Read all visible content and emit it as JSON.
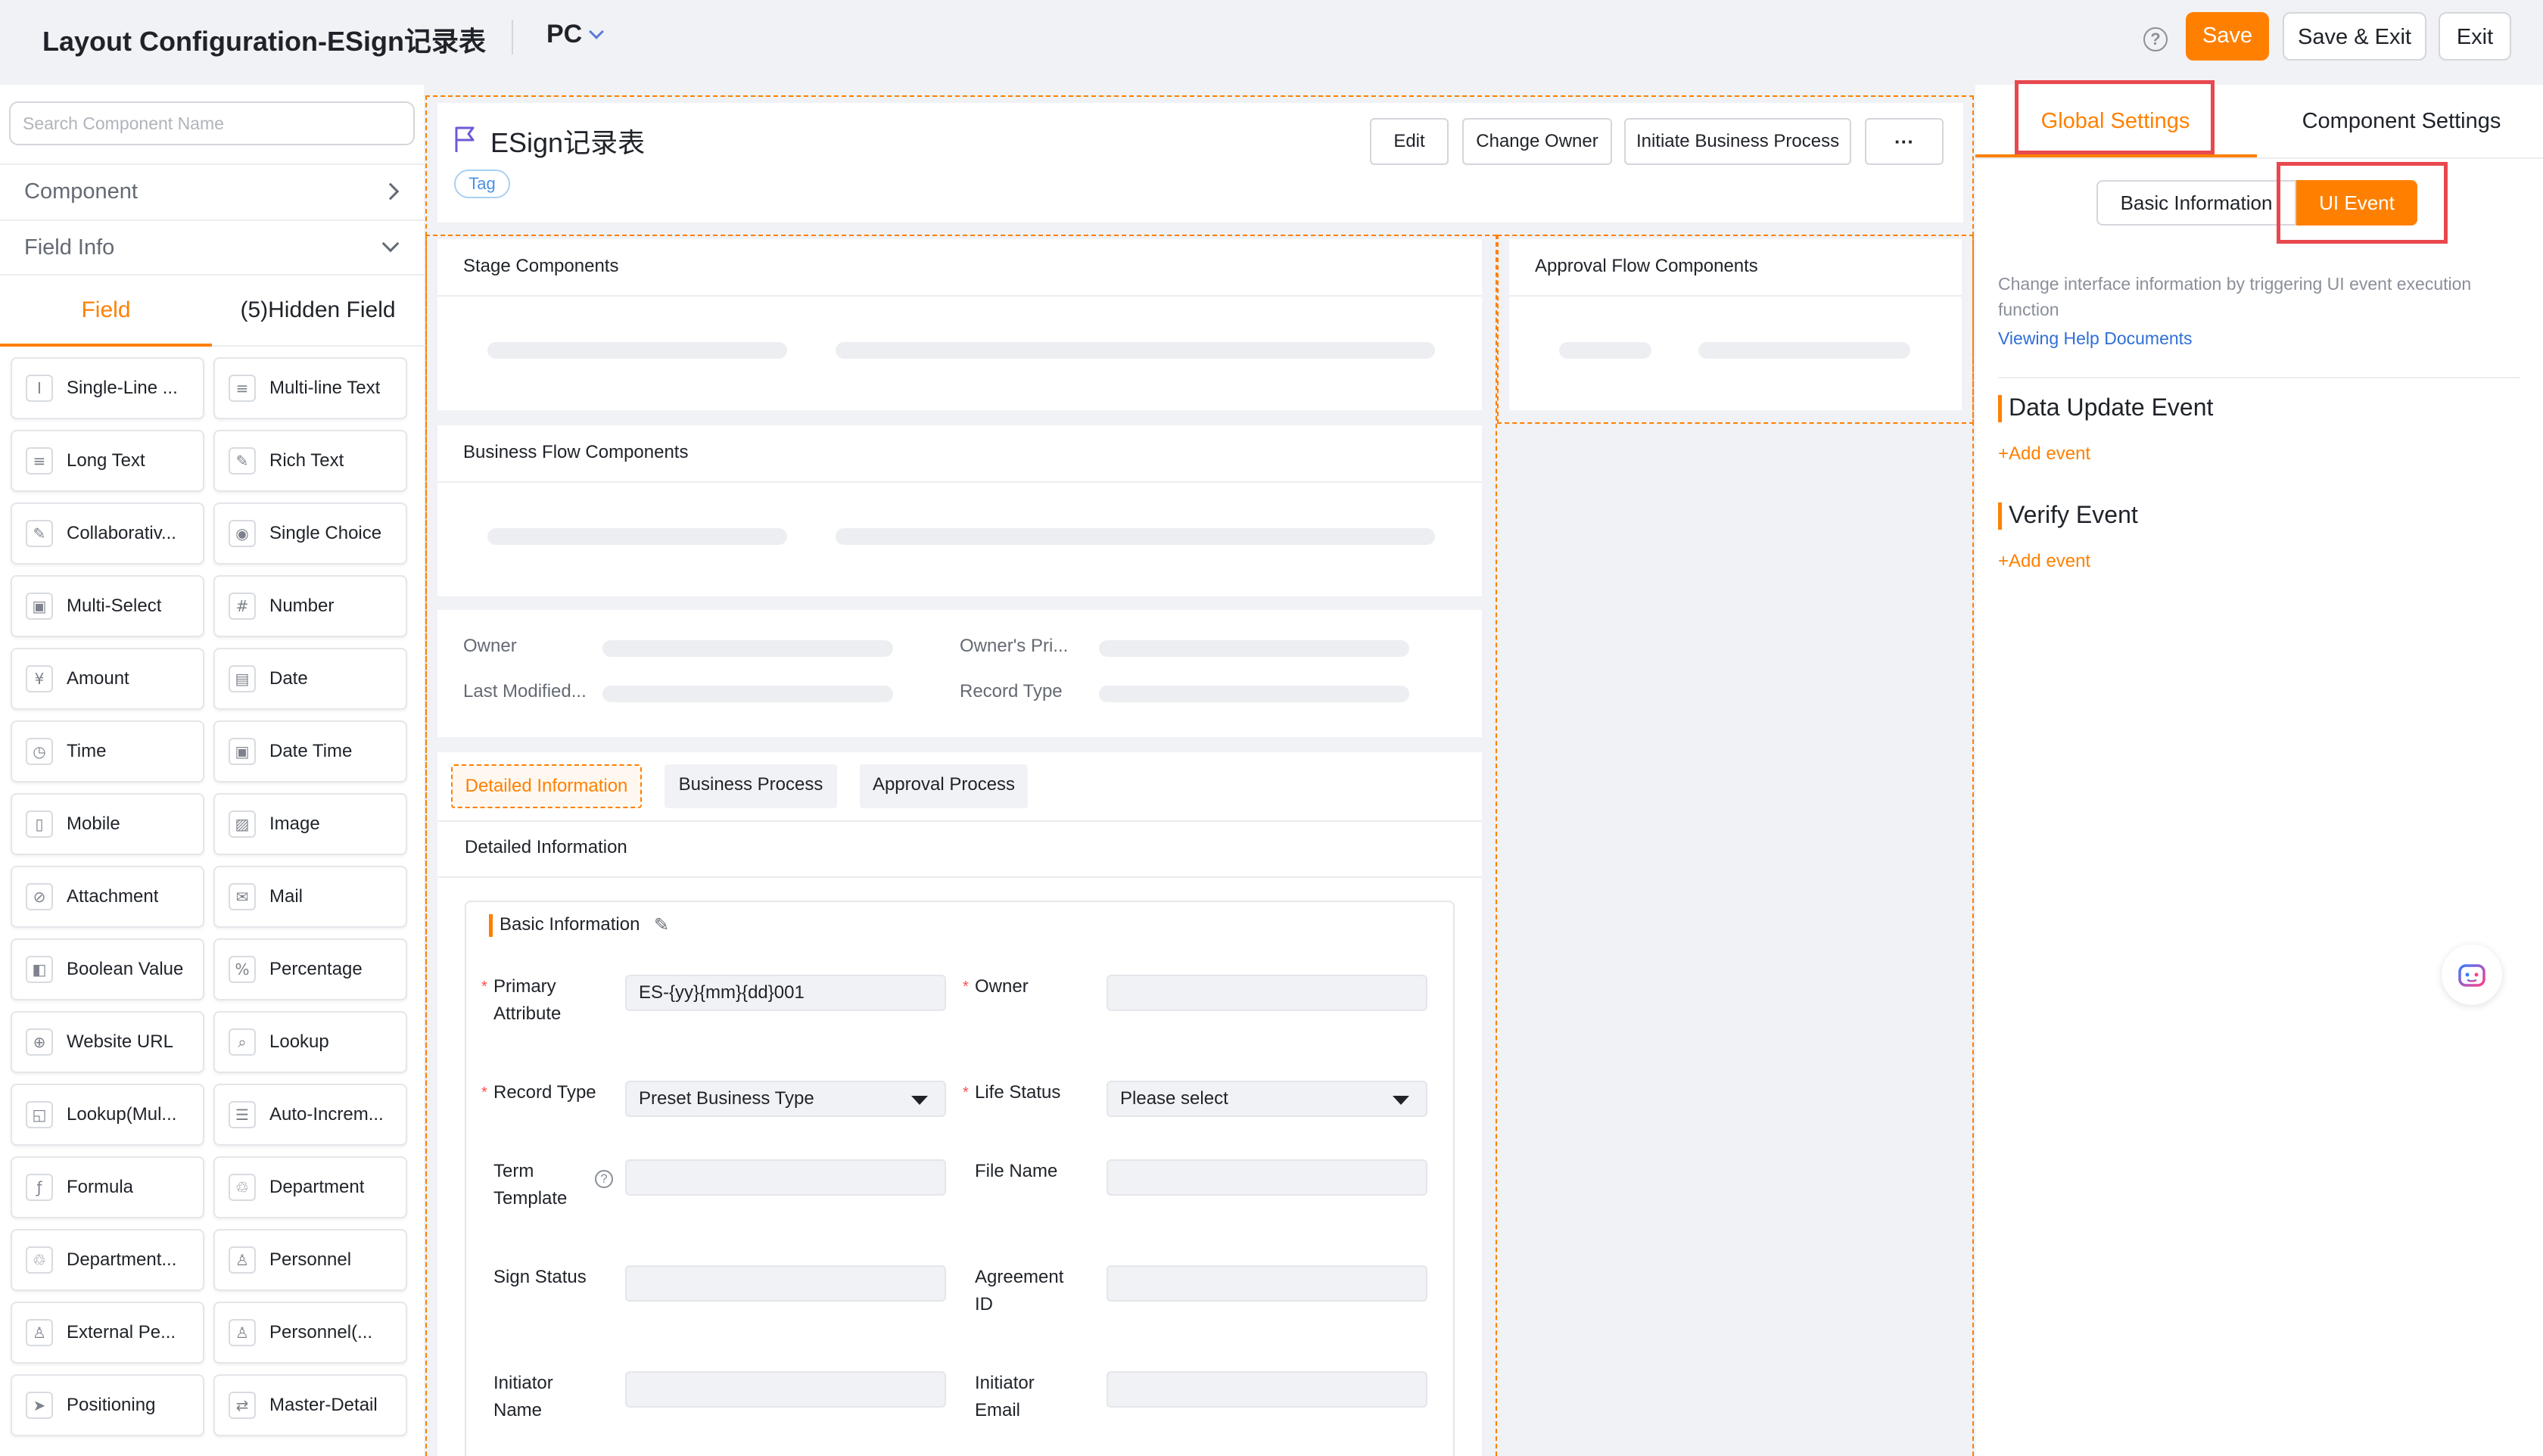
{
  "header": {
    "title": "Layout Configuration-ESign记录表",
    "device": "PC",
    "help_icon": "question-circle-icon",
    "save_label": "Save",
    "save_exit_label": "Save & Exit",
    "exit_label": "Exit"
  },
  "sidebar": {
    "search_placeholder": "Search Component Name",
    "component_label": "Component",
    "field_info_label": "Field Info",
    "tab_field": "Field",
    "tab_hidden": "(5)Hidden Field",
    "fields": [
      {
        "label": "Single-Line ...",
        "icon": "I"
      },
      {
        "label": "Multi-line Text",
        "icon": "≡"
      },
      {
        "label": "Long Text",
        "icon": "≡"
      },
      {
        "label": "Rich Text",
        "icon": "✎"
      },
      {
        "label": "Collaborativ...",
        "icon": "✎"
      },
      {
        "label": "Single Choice",
        "icon": "◉"
      },
      {
        "label": "Multi-Select",
        "icon": "▣"
      },
      {
        "label": "Number",
        "icon": "#"
      },
      {
        "label": "Amount",
        "icon": "¥"
      },
      {
        "label": "Date",
        "icon": "▤"
      },
      {
        "label": "Time",
        "icon": "◷"
      },
      {
        "label": "Date Time",
        "icon": "▣"
      },
      {
        "label": "Mobile",
        "icon": "▯"
      },
      {
        "label": "Image",
        "icon": "▨"
      },
      {
        "label": "Attachment",
        "icon": "⊘"
      },
      {
        "label": "Mail",
        "icon": "✉"
      },
      {
        "label": "Boolean Value",
        "icon": "◧"
      },
      {
        "label": "Percentage",
        "icon": "%"
      },
      {
        "label": "Website URL",
        "icon": "⊕"
      },
      {
        "label": "Lookup",
        "icon": "⌕"
      },
      {
        "label": "Lookup(Mul...",
        "icon": "◱"
      },
      {
        "label": "Auto-Increm...",
        "icon": "☰"
      },
      {
        "label": "Formula",
        "icon": "ƒ"
      },
      {
        "label": "Department",
        "icon": "♲"
      },
      {
        "label": "Department...",
        "icon": "♲"
      },
      {
        "label": "Personnel",
        "icon": "♙"
      },
      {
        "label": "External Pe...",
        "icon": "♙"
      },
      {
        "label": "Personnel(...",
        "icon": "♙"
      },
      {
        "label": "Positioning",
        "icon": "➤"
      },
      {
        "label": "Master-Detail",
        "icon": "⇄"
      }
    ]
  },
  "record": {
    "title": "ESign记录表",
    "tag": "Tag",
    "edit_label": "Edit",
    "change_owner_label": "Change Owner",
    "initiate_label": "Initiate Business Process",
    "more_label": "···"
  },
  "canvas": {
    "stage_title": "Stage Components",
    "approval_title": "Approval Flow Components",
    "bizflow_title": "Business Flow Components",
    "owner_label": "Owner",
    "owner_pri_label": "Owner's Pri...",
    "last_modified_label": "Last Modified...",
    "record_type_label": "Record Type"
  },
  "detail_tabs": {
    "detailed": "Detailed Information",
    "business_process": "Business Process",
    "approval_process": "Approval Process",
    "heading": "Detailed Information"
  },
  "form": {
    "section_title": "Basic Information",
    "primary_attribute_label": "Primary Attribute",
    "primary_attribute_value": "ES-{yy}{mm}{dd}001",
    "owner_label": "Owner",
    "record_type_label": "Record Type",
    "record_type_value": "Preset Business Type",
    "life_status_label": "Life Status",
    "life_status_value": "Please select",
    "term_template_label": "Term Template",
    "file_name_label": "File Name",
    "sign_status_label": "Sign Status",
    "agreement_id_label": "Agreement ID",
    "initiator_name_label": "Initiator Name",
    "initiator_email_label": "Initiator Email"
  },
  "right_panel": {
    "tab_global": "Global Settings",
    "tab_component": "Component Settings",
    "seg_basic": "Basic Information",
    "seg_ui_event": "UI Event",
    "description": "Change interface information by triggering UI event execution function",
    "help_link": "Viewing Help Documents",
    "data_update_event": "Data Update Event",
    "verify_event": "Verify Event",
    "add_event_1": "+Add event",
    "add_event_2": "+Add event"
  },
  "colors": {
    "accent": "#ff8000",
    "highlight_box": "#e8484e",
    "link": "#2f6fd6"
  }
}
